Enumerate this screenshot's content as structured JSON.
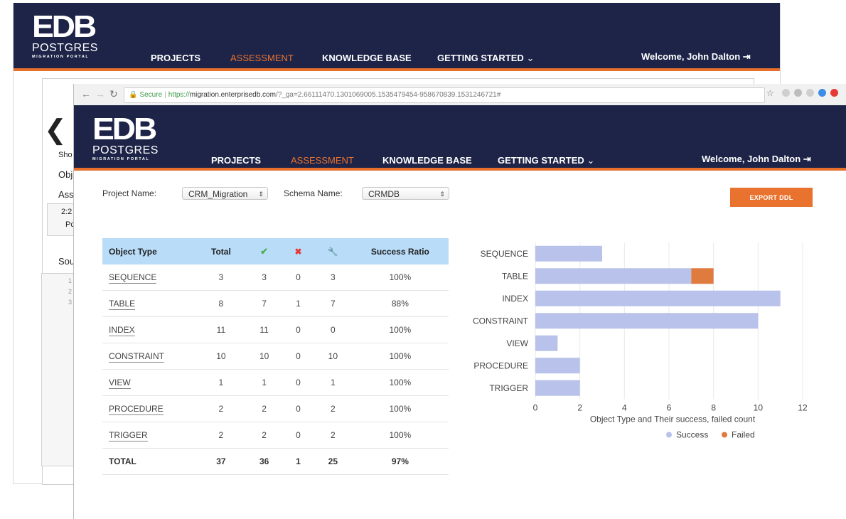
{
  "app": {
    "logo_edb": "EDB",
    "logo_postgres": "POSTGRES",
    "logo_subtitle": "MIGRATION PORTAL",
    "nav": [
      "PROJECTS",
      "ASSESSMENT",
      "KNOWLEDGE BASE",
      "GETTING STARTED"
    ],
    "active_nav": "ASSESSMENT",
    "welcome": "Welcome, John Dalton"
  },
  "back_window": {
    "fragments": [
      "Sho",
      "Obj",
      "Ass",
      "2:2",
      "Pc",
      "Sou",
      "1",
      "2",
      "3"
    ]
  },
  "browser": {
    "secure_label": "Secure",
    "url_prefix": "https://",
    "url": "migration.enterprisedb.com",
    "url_rest": "/?_ga=2.66111470.1301069005.1535479454-958670839.1531246721#"
  },
  "form": {
    "project_label": "Project Name:",
    "project_value": "CRM_Migration",
    "schema_label": "Schema Name:",
    "schema_value": "CRMDB",
    "export_label": "EXPORT DDL"
  },
  "table": {
    "headers": [
      "Object Type",
      "Total",
      "✔",
      "✖",
      "🔧",
      "Success Ratio"
    ],
    "rows": [
      {
        "type": "SEQUENCE",
        "total": "3",
        "success": "3",
        "failed": "0",
        "fixed": "3",
        "ratio": "100%"
      },
      {
        "type": "TABLE",
        "total": "8",
        "success": "7",
        "failed": "1",
        "fixed": "7",
        "ratio": "88%"
      },
      {
        "type": "INDEX",
        "total": "11",
        "success": "11",
        "failed": "0",
        "fixed": "0",
        "ratio": "100%"
      },
      {
        "type": "CONSTRAINT",
        "total": "10",
        "success": "10",
        "failed": "0",
        "fixed": "10",
        "ratio": "100%"
      },
      {
        "type": "VIEW",
        "total": "1",
        "success": "1",
        "failed": "0",
        "fixed": "1",
        "ratio": "100%"
      },
      {
        "type": "PROCEDURE",
        "total": "2",
        "success": "2",
        "failed": "0",
        "fixed": "2",
        "ratio": "100%"
      },
      {
        "type": "TRIGGER",
        "total": "2",
        "success": "2",
        "failed": "0",
        "fixed": "2",
        "ratio": "100%"
      }
    ],
    "total_row": {
      "type": "TOTAL",
      "total": "37",
      "success": "36",
      "failed": "1",
      "fixed": "25",
      "ratio": "97%"
    }
  },
  "chart_data": {
    "type": "bar",
    "orientation": "horizontal",
    "stacked": true,
    "categories": [
      "SEQUENCE",
      "TABLE",
      "INDEX",
      "CONSTRAINT",
      "VIEW",
      "PROCEDURE",
      "TRIGGER"
    ],
    "series": [
      {
        "name": "Success",
        "values": [
          3,
          7,
          11,
          10,
          1,
          2,
          2
        ],
        "color": "#b8c2ea"
      },
      {
        "name": "Failed",
        "values": [
          0,
          1,
          0,
          0,
          0,
          0,
          0
        ],
        "color": "#e07b40"
      }
    ],
    "xlabel": "Object Type and Their success, failed count",
    "xlim": [
      0,
      12
    ],
    "xticks": [
      0,
      2,
      4,
      6,
      8,
      10,
      12
    ],
    "grid": true,
    "legend": "bottom-center"
  }
}
